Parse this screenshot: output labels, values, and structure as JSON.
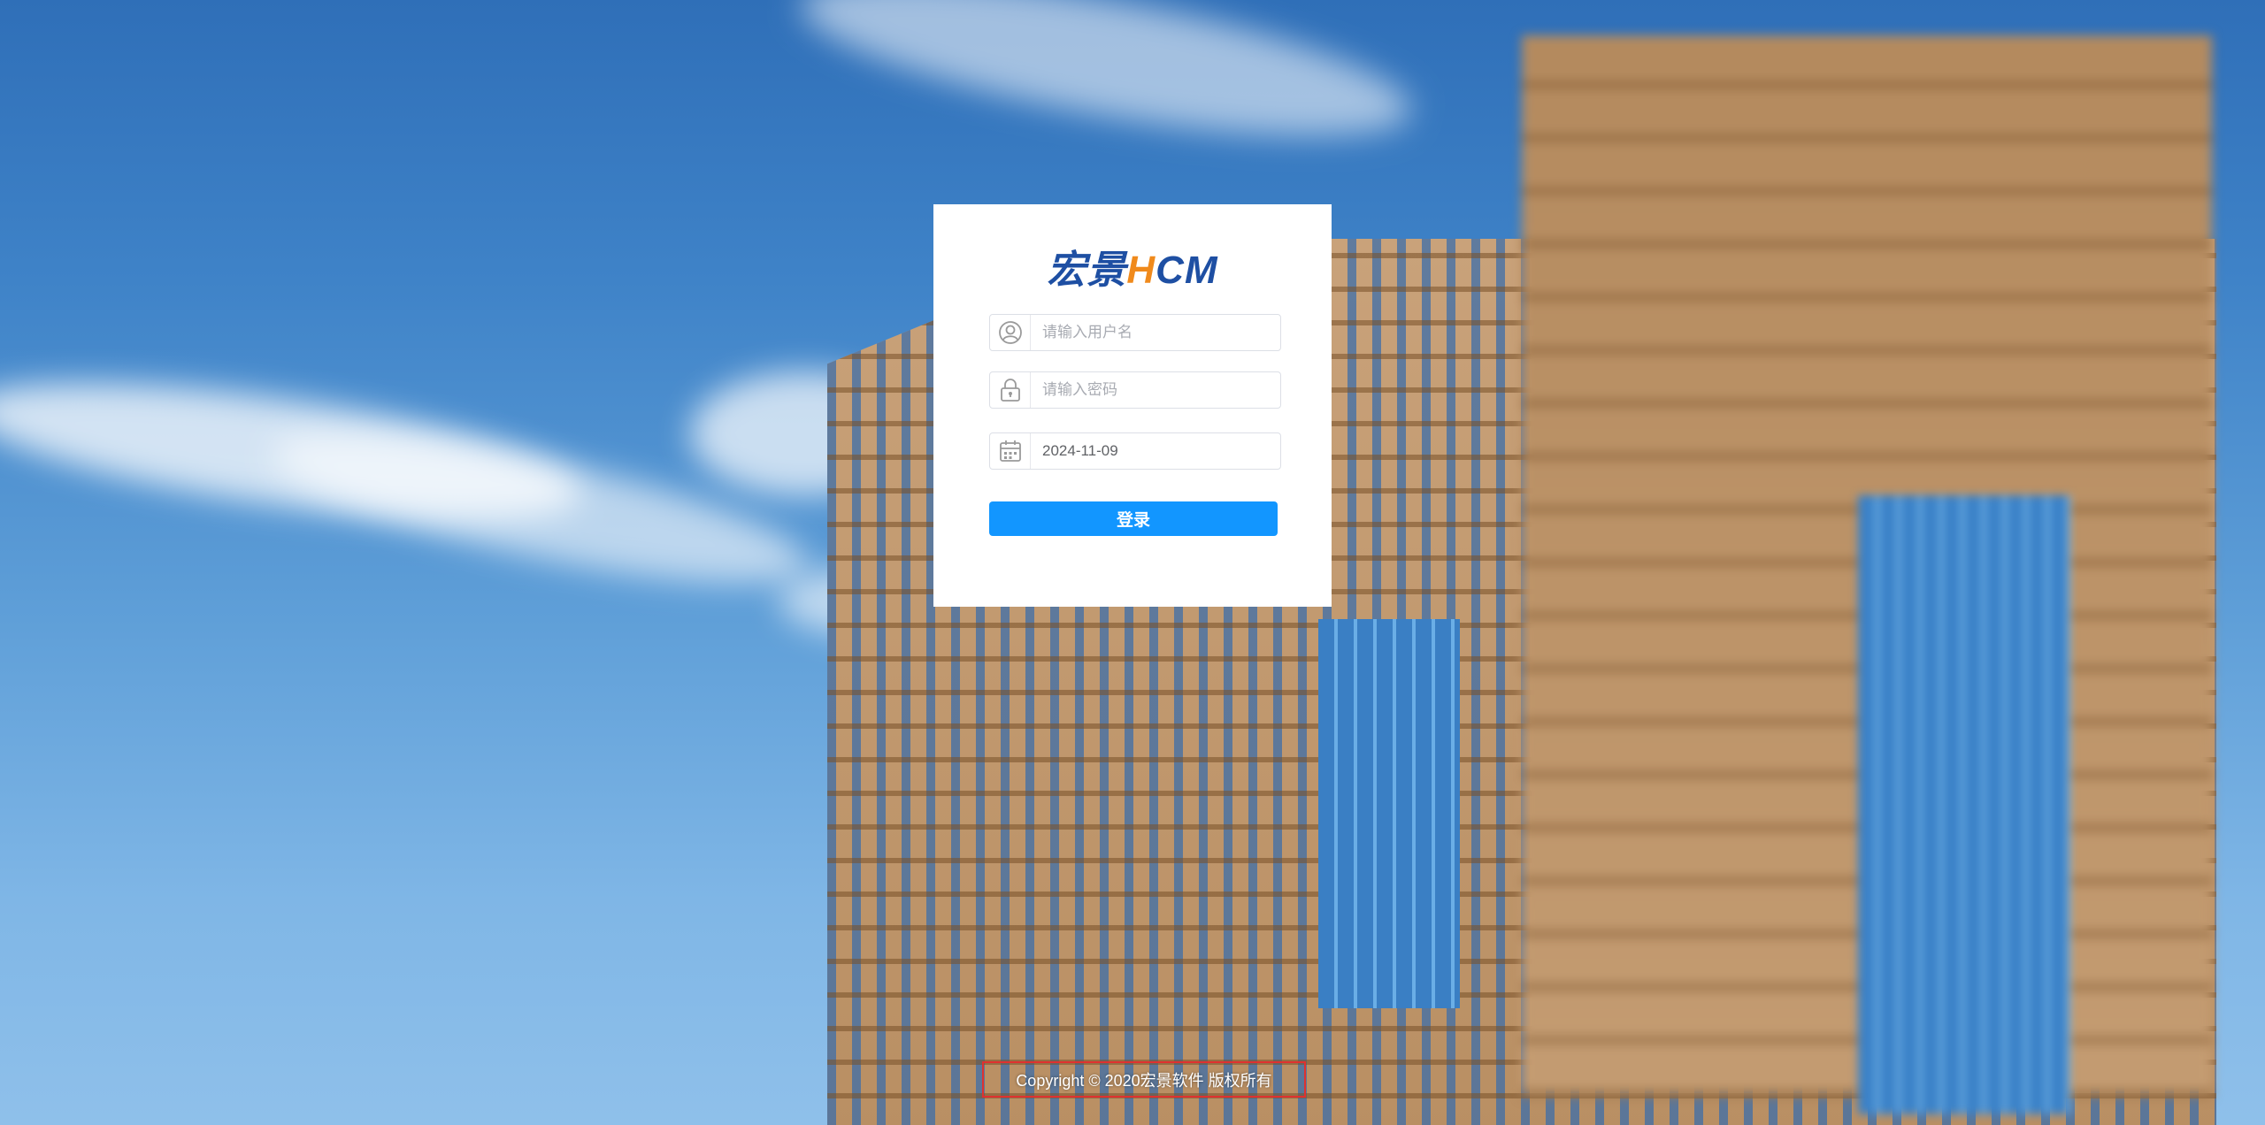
{
  "logo": {
    "cn": "宏景",
    "h": "H",
    "cm": "CM"
  },
  "login_form": {
    "username": {
      "placeholder": "请输入用户名",
      "value": ""
    },
    "password": {
      "placeholder": "请输入密码",
      "value": ""
    },
    "date": {
      "placeholder": "",
      "value": "2024-11-09"
    },
    "submit_label": "登录"
  },
  "footer": {
    "copyright": "Copyright © 2020宏景软件 版权所有"
  },
  "icons": {
    "user": "user-icon",
    "lock": "lock-icon",
    "calendar": "calendar-icon"
  },
  "colors": {
    "primary_button": "#1296ff",
    "logo_blue": "#1e4fa3",
    "logo_orange": "#f08a1c",
    "highlight_border": "#e0312f"
  }
}
